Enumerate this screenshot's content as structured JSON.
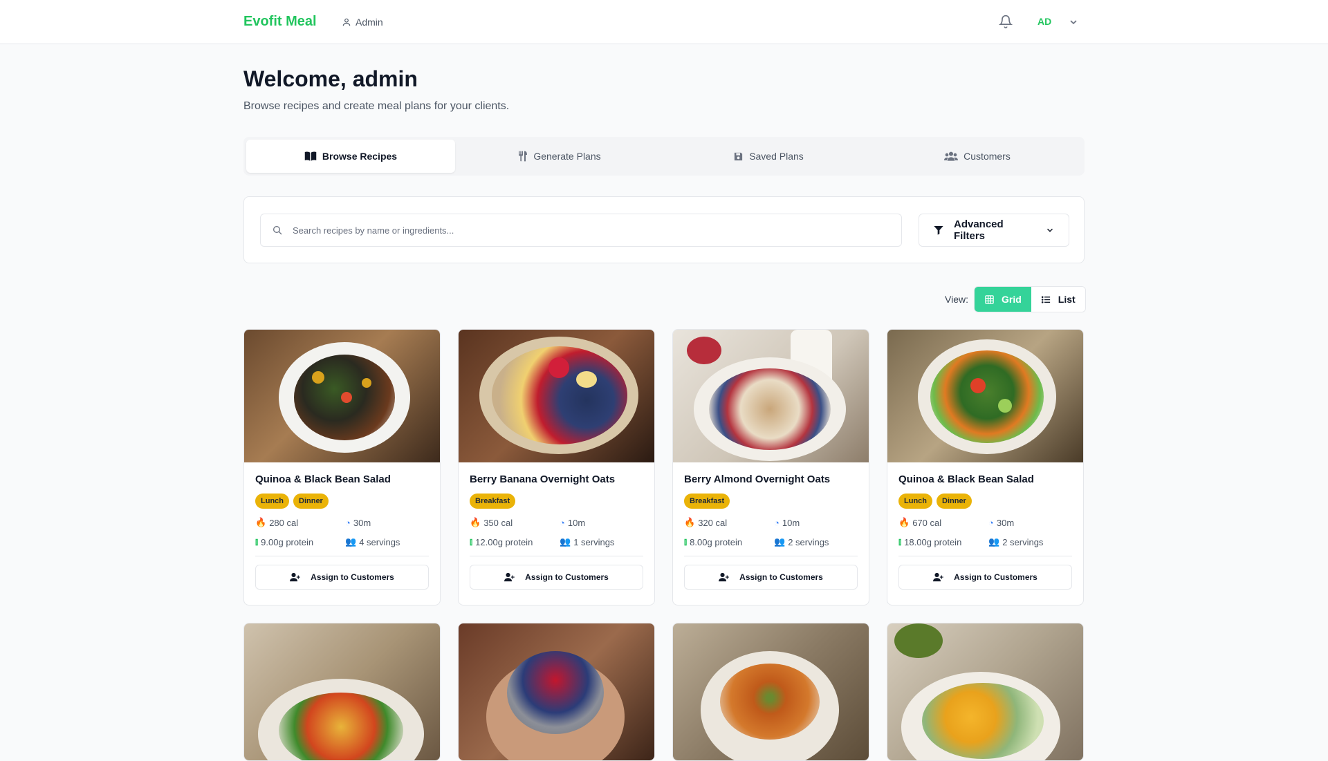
{
  "header": {
    "brand": "Evofit Meal",
    "role": "Admin",
    "avatar_initials": "AD",
    "accent_color": "#22c55e"
  },
  "welcome": {
    "title": "Welcome, admin",
    "subtitle": "Browse recipes and create meal plans for your clients."
  },
  "tabs": [
    {
      "label": "Browse Recipes",
      "icon": "book-open-icon",
      "active": true
    },
    {
      "label": "Generate Plans",
      "icon": "utensils-icon",
      "active": false
    },
    {
      "label": "Saved Plans",
      "icon": "save-icon",
      "active": false
    },
    {
      "label": "Customers",
      "icon": "users-icon",
      "active": false
    }
  ],
  "search": {
    "placeholder": "Search recipes by name or ingredients...",
    "value": "",
    "filters_label": "Advanced Filters"
  },
  "view": {
    "label": "View:",
    "grid_label": "Grid",
    "list_label": "List",
    "selected": "Grid"
  },
  "recipes": [
    {
      "title": "Quinoa & Black Bean Salad",
      "tags": [
        "Lunch",
        "Dinner"
      ],
      "calories": "280 cal",
      "time": "30m",
      "protein": "9.00g protein",
      "servings": "4 servings",
      "action": "Assign to Customers"
    },
    {
      "title": "Berry Banana Overnight Oats",
      "tags": [
        "Breakfast"
      ],
      "calories": "350 cal",
      "time": "10m",
      "protein": "12.00g protein",
      "servings": "1 servings",
      "action": "Assign to Customers"
    },
    {
      "title": "Berry Almond Overnight Oats",
      "tags": [
        "Breakfast"
      ],
      "calories": "320 cal",
      "time": "10m",
      "protein": "8.00g protein",
      "servings": "2 servings",
      "action": "Assign to Customers"
    },
    {
      "title": "Quinoa & Black Bean Salad",
      "tags": [
        "Lunch",
        "Dinner"
      ],
      "calories": "670 cal",
      "time": "30m",
      "protein": "18.00g protein",
      "servings": "2 servings",
      "action": "Assign to Customers"
    }
  ],
  "tag_color": "#eab308"
}
